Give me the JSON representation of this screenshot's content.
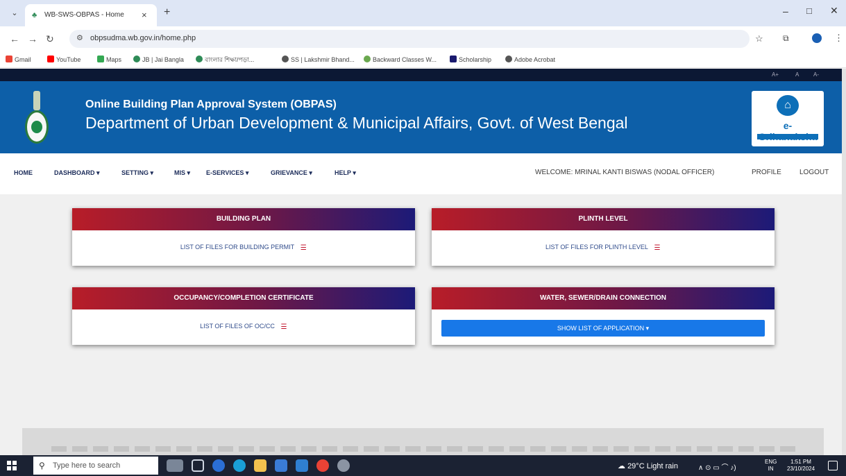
{
  "browser": {
    "tab_title": "WB-SWS-OBPAS - Home",
    "tab_close": "×",
    "new_tab": "+",
    "url": "obpsudma.wb.gov.in/home.php",
    "bookmarks": [
      "Gmail",
      "YouTube",
      "Maps",
      "JB | Jai Bangla",
      "বাংলার শিক্ষা/পড়া...",
      "SS | Lakshmir Bhand...",
      "Backward Classes W...",
      "Scholarship",
      "Adobe Acrobat"
    ]
  },
  "header": {
    "font_controls": [
      "A+",
      "A",
      "A-"
    ],
    "title": "Online Building Plan Approval System (OBPAS)",
    "subtitle": "Department of Urban Development & Municipal Affairs, Govt. of West Bengal",
    "logo_text": "e-Grihanaksha"
  },
  "nav": {
    "items": [
      "HOME",
      "DASHBOARD ▾",
      "SETTING ▾",
      "MIS ▾",
      "E-SERVICES ▾",
      "GRIEVANCE ▾",
      "HELP ▾"
    ],
    "welcome": "WELCOME: MRINAL KANTI BISWAS (NODAL OFFICER)",
    "profile": "PROFILE",
    "logout": "LOGOUT"
  },
  "cards": [
    {
      "title": "BUILDING PLAN",
      "link": "LIST OF FILES FOR BUILDING PERMIT"
    },
    {
      "title": "PLINTH LEVEL",
      "link": "LIST OF FILES FOR PLINTH LEVEL"
    },
    {
      "title": "OCCUPANCY/COMPLETION CERTIFICATE",
      "link": "LIST OF FILES OF OC/CC"
    },
    {
      "title": "WATER, SEWER/DRAIN CONNECTION",
      "button": "SHOW LIST OF APPLICATION ▾"
    }
  ],
  "taskbar": {
    "search_placeholder": "Type here to search",
    "weather": "29°C Light rain",
    "lang_top": "ENG",
    "lang_bottom": "IN",
    "time": "1:51 PM",
    "date": "23/10/2024"
  },
  "colors": {
    "banner": "#0d5fa8",
    "card_gradient_start": "#b81d28",
    "card_gradient_end": "#1c1a78",
    "button": "#1878e8"
  }
}
